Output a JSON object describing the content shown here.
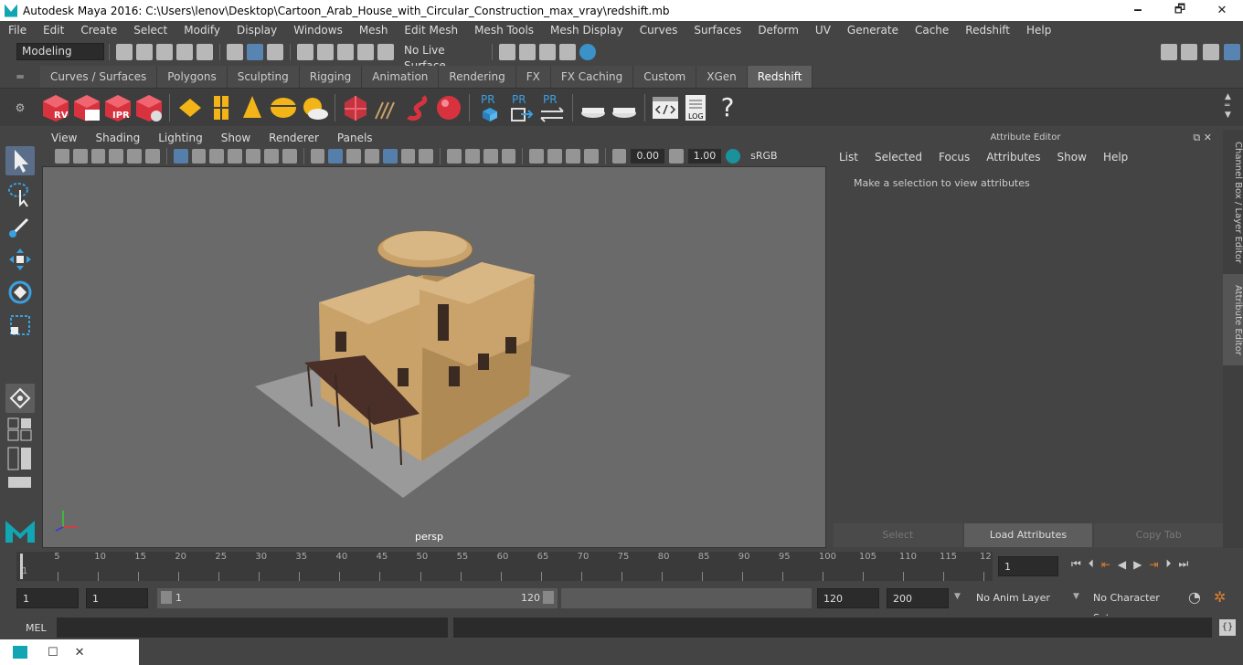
{
  "window": {
    "title": "Autodesk Maya 2016: C:\\Users\\lenov\\Desktop\\Cartoon_Arab_House_with_Circular_Construction_max_vray\\redshift.mb",
    "minimize": "🗕",
    "maximize": "🗗",
    "close": "✕"
  },
  "menubar": [
    "File",
    "Edit",
    "Create",
    "Select",
    "Modify",
    "Display",
    "Windows",
    "Mesh",
    "Edit Mesh",
    "Mesh Tools",
    "Mesh Display",
    "Curves",
    "Surfaces",
    "Deform",
    "UV",
    "Generate",
    "Cache",
    "Redshift",
    "Help"
  ],
  "statusline": {
    "mode": "Modeling",
    "live_surface": "No Live Surface"
  },
  "shelf_tabs": [
    "Curves / Surfaces",
    "Polygons",
    "Sculpting",
    "Rigging",
    "Animation",
    "Rendering",
    "FX",
    "FX Caching",
    "Custom",
    "XGen",
    "Redshift"
  ],
  "active_shelf": "Redshift",
  "shelf_labels": {
    "rv": "RV",
    "ipr": "IPR",
    "pr1": "PR",
    "pr2": "PR",
    "pr3": "PR",
    "log": "LOG",
    "help": "?"
  },
  "viewport_menu": [
    "View",
    "Shading",
    "Lighting",
    "Show",
    "Renderer",
    "Panels"
  ],
  "viewport_tools": {
    "near": "0.00",
    "far": "1.00",
    "color_mgmt": "sRGB gamma"
  },
  "camera": "persp",
  "attribute_editor": {
    "title": "Attribute Editor",
    "menu": [
      "List",
      "Selected",
      "Focus",
      "Attributes",
      "Show",
      "Help"
    ],
    "message": "Make a selection to view attributes",
    "buttons": {
      "select": "Select",
      "load": "Load Attributes",
      "copy": "Copy Tab"
    }
  },
  "side_tabs": {
    "channel_box": "Channel Box / Layer Editor",
    "attribute_editor": "Attribute Editor"
  },
  "timeline": {
    "ticks": [
      "5",
      "10",
      "15",
      "20",
      "25",
      "30",
      "35",
      "40",
      "45",
      "50",
      "55",
      "60",
      "65",
      "70",
      "75",
      "80",
      "85",
      "90",
      "95",
      "100",
      "105",
      "110",
      "115",
      "12"
    ],
    "current_frame": "1",
    "start_marker": "1"
  },
  "range": {
    "start": "1",
    "playback_start": "1",
    "slider_start": "1",
    "slider_end": "120",
    "playback_end": "120",
    "end": "200",
    "anim_layer": "No Anim Layer",
    "character_set": "No Character Set"
  },
  "cmdline": {
    "label": "MEL"
  },
  "colors": {
    "accent": "#12a5b3",
    "house": "#c9a26a",
    "ground": "#9a9a9a",
    "redshift_red": "#d9323f",
    "shelf_yellow": "#f2b417",
    "pr_blue": "#3aa0e0"
  }
}
